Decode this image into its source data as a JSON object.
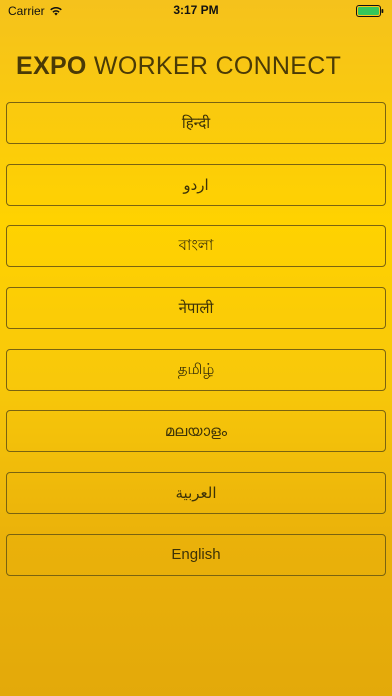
{
  "status_bar": {
    "carrier": "Carrier",
    "time": "3:17 PM",
    "battery_color": "#34c759"
  },
  "header": {
    "title_bold": "EXPO",
    "title_rest": "WORKER CONNECT"
  },
  "languages": [
    {
      "label": "हिन्दी"
    },
    {
      "label": "اردو"
    },
    {
      "label": "বাংলা"
    },
    {
      "label": "नेपाली"
    },
    {
      "label": "தமிழ்"
    },
    {
      "label": "മലയാളം"
    },
    {
      "label": "العربية"
    },
    {
      "label": "English"
    }
  ],
  "icons": {
    "wifi": "wifi-icon",
    "battery": "battery-icon"
  }
}
